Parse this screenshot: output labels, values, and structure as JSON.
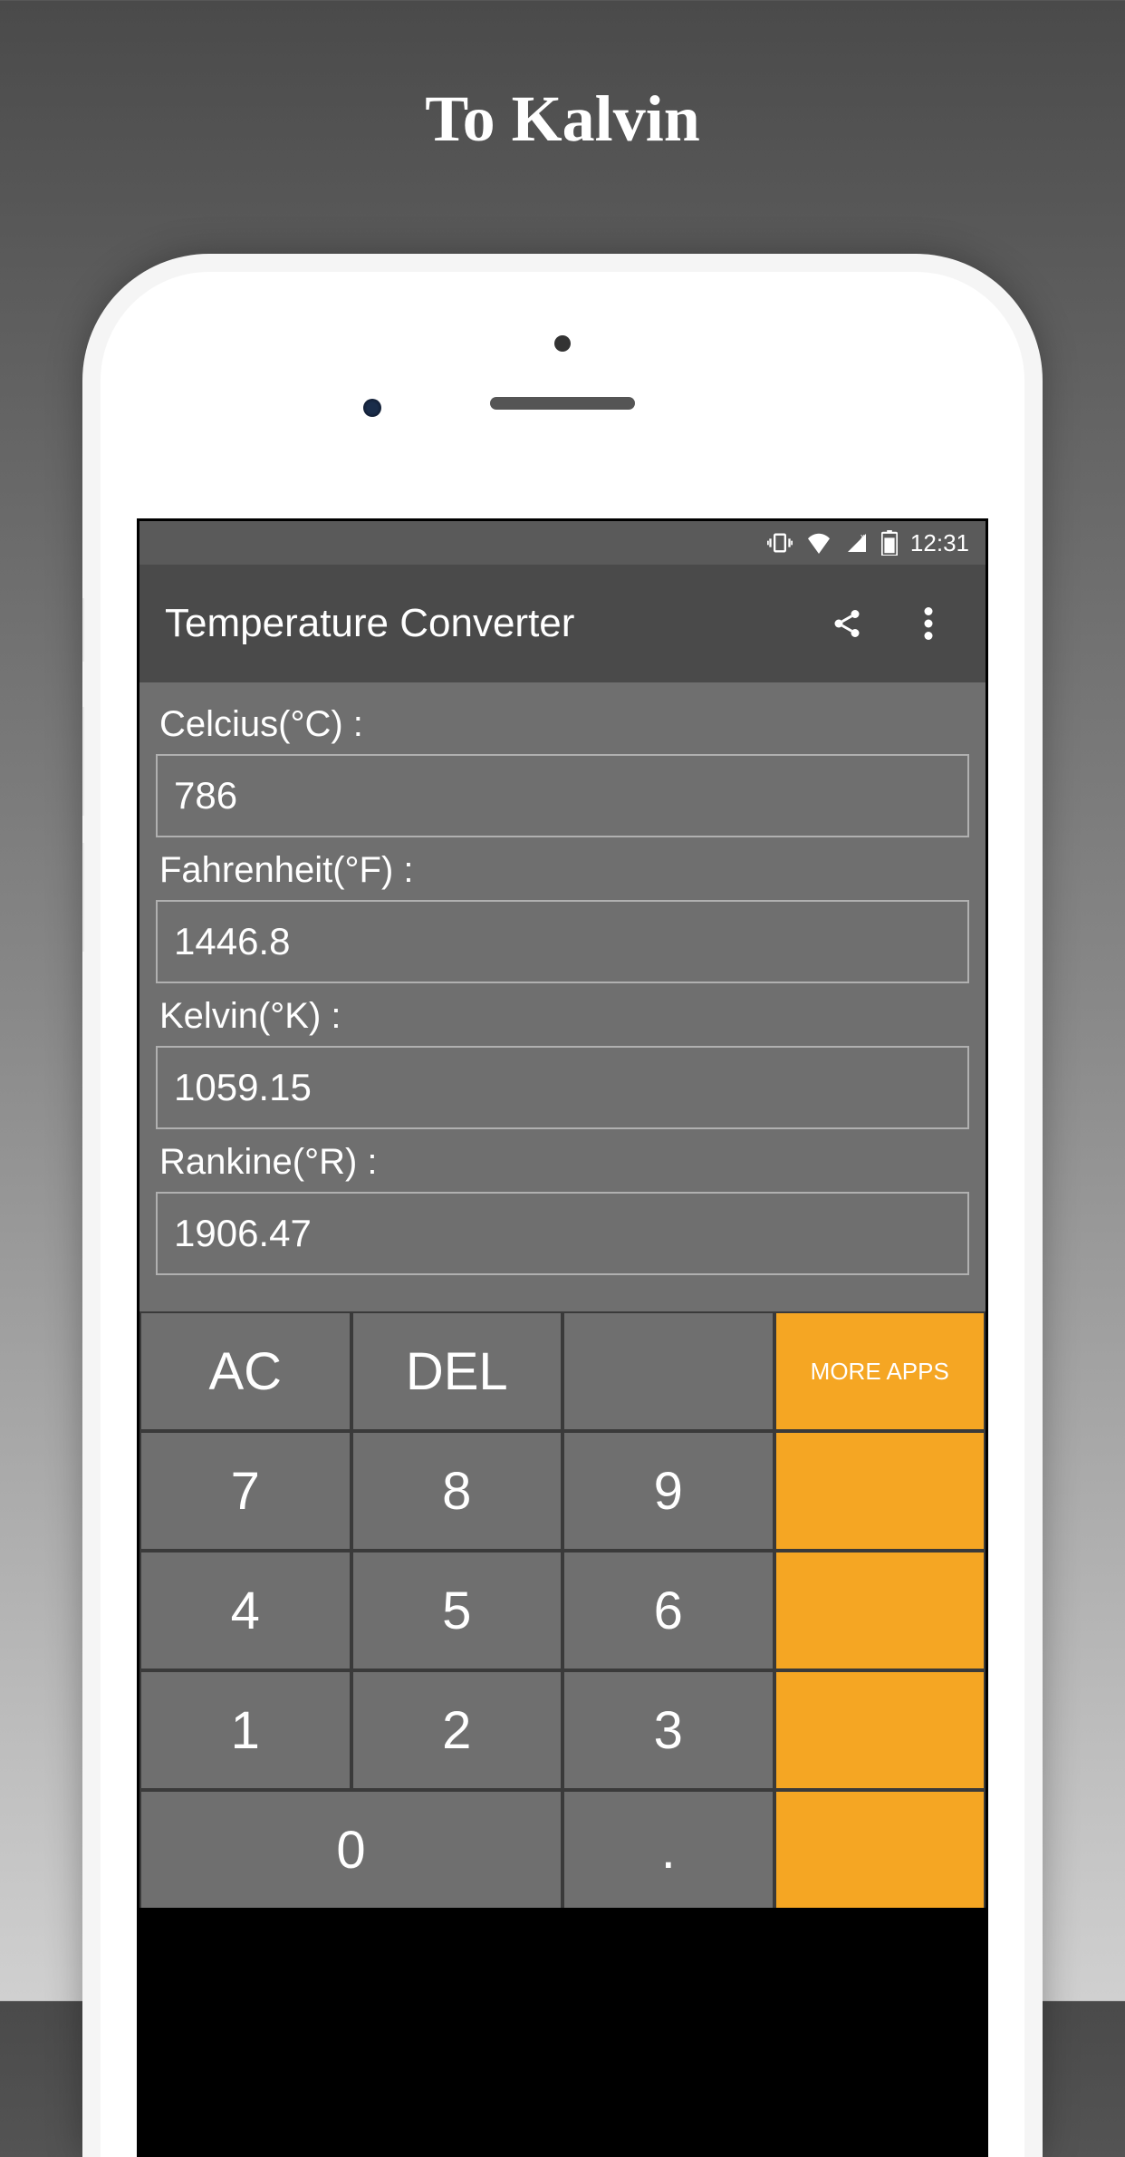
{
  "page_title": "To Kalvin",
  "status_bar": {
    "time": "12:31"
  },
  "app_bar": {
    "title": "Temperature Converter"
  },
  "fields": [
    {
      "label": "Celcius(°C) :",
      "value": "786"
    },
    {
      "label": "Fahrenheit(°F) :",
      "value": "1446.8"
    },
    {
      "label": "Kelvin(°K) :",
      "value": "1059.15"
    },
    {
      "label": "Rankine(°R) :",
      "value": "1906.47"
    }
  ],
  "keypad": {
    "ac": "AC",
    "del": "DEL",
    "empty": "",
    "more_apps": "MORE APPS",
    "k7": "7",
    "k8": "8",
    "k9": "9",
    "k4": "4",
    "k5": "5",
    "k6": "6",
    "k1": "1",
    "k2": "2",
    "k3": "3",
    "k0": "0",
    "kdot": "."
  }
}
